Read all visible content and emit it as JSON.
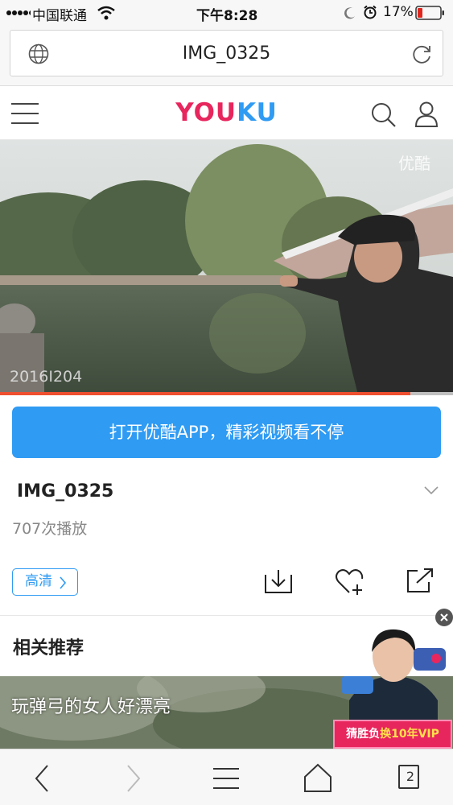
{
  "status_bar": {
    "carrier": "中国联通",
    "time": "下午8:28",
    "battery": "17%"
  },
  "address_bar": {
    "title": "IMG_0325",
    "left_icon": "globe-icon",
    "right_icon": "reload-icon"
  },
  "header": {
    "logo_text": "YOUKU",
    "logo_colors": {
      "you": "#e8265e",
      "ku": "#2f9bf3"
    },
    "icons": [
      "menu-icon",
      "search-icon",
      "user-icon"
    ]
  },
  "video": {
    "watermark": "优酷",
    "date_stamp": "2016I204",
    "progress": 0.906,
    "progress_color": "#ef4f2f"
  },
  "open_app_button": {
    "label": "打开优酷APP，精彩视频看不停",
    "color": "#2f9bf3"
  },
  "video_info": {
    "title": "IMG_0325",
    "play_count": "707次播放"
  },
  "actions": {
    "hd_label": "高清",
    "icons": [
      "download-icon",
      "favorite-add-icon",
      "share-icon"
    ]
  },
  "related": {
    "title": "相关推荐",
    "items": [
      {
        "label": "玩弹弓的女人好漂亮"
      }
    ]
  },
  "ad": {
    "text_prefix": "猜胜负",
    "text_highlight": "换10年VIP"
  },
  "toolbar": {
    "tabs_count": "2",
    "icons": [
      "back-icon",
      "forward-icon",
      "menu-icon",
      "home-icon",
      "tabs-icon"
    ]
  }
}
